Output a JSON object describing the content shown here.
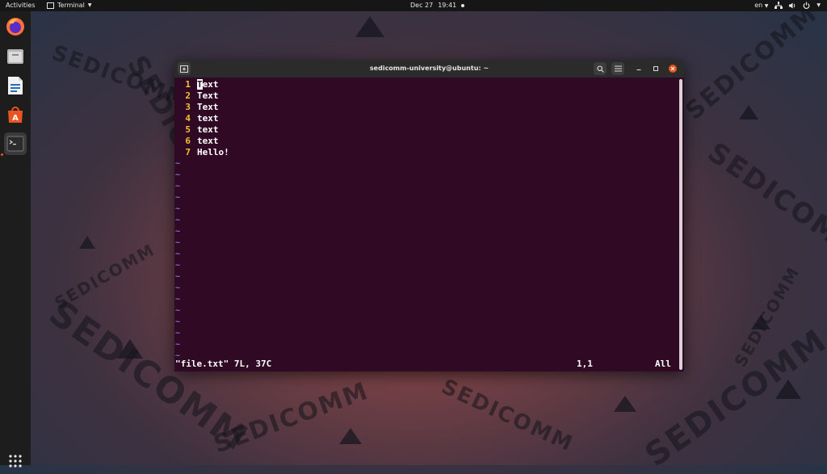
{
  "topbar": {
    "activities": "Activities",
    "app_name": "Terminal",
    "date": "Dec 27",
    "time": "19:41",
    "lang": "en"
  },
  "dock": {
    "items": [
      {
        "name": "firefox",
        "icon": "firefox-icon"
      },
      {
        "name": "files",
        "icon": "files-icon"
      },
      {
        "name": "writer",
        "icon": "libreoffice-writer-icon"
      },
      {
        "name": "software",
        "icon": "ubuntu-software-icon"
      },
      {
        "name": "terminal",
        "icon": "terminal-icon"
      }
    ],
    "show_apps_icon": "show-applications-icon"
  },
  "terminal": {
    "title": "sedicomm-university@ubuntu: ~",
    "lines": [
      {
        "num": "1",
        "text": "Text"
      },
      {
        "num": "2",
        "text": "Text"
      },
      {
        "num": "3",
        "text": "Text"
      },
      {
        "num": "4",
        "text": "text"
      },
      {
        "num": "5",
        "text": "text"
      },
      {
        "num": "6",
        "text": "text"
      },
      {
        "num": "7",
        "text": "Hello!"
      }
    ],
    "tilde": "~",
    "status_file": "\"file.txt\" 7L, 37C",
    "status_pos": "1,1",
    "status_scroll": "All",
    "colors": {
      "background": "#300a24",
      "line_numbers": "#f5c12e",
      "tildes": "#7d7dd8"
    }
  },
  "wallpaper": {
    "brand_text": "SEDICOMM"
  }
}
